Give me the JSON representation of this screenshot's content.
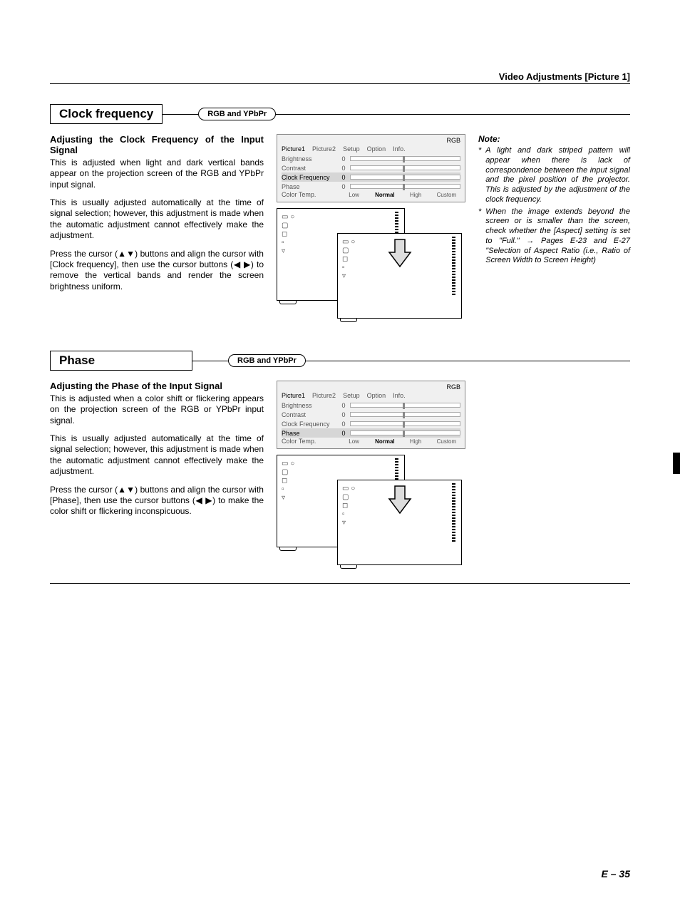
{
  "header": {
    "chapter": "Video Adjustments [Picture 1]"
  },
  "section1": {
    "title": "Clock frequency",
    "badge": "RGB and YPbPr",
    "subhead": "Adjusting the Clock Frequency of the Input Signal",
    "p1": "This is adjusted when light and dark vertical bands appear on the projection screen of the RGB and YPbPr input signal.",
    "p2": "This is usually adjusted automatically at the time of signal selection; however, this adjustment is made when the automatic adjustment cannot effectively make the adjustment.",
    "p3a": "Press the cursor (",
    "p3b": ") buttons and align the cursor with [Clock frequency], then use the cursor buttons (",
    "p3c": ") to remove the vertical bands and render the screen brightness uniform."
  },
  "menu": {
    "top": "RGB",
    "tabs": [
      "Picture1",
      "Picture2",
      "Setup",
      "Option",
      "Info."
    ],
    "rows": [
      {
        "label": "Brightness",
        "val": "0"
      },
      {
        "label": "Contrast",
        "val": "0"
      },
      {
        "label": "Clock Frequency",
        "val": "0"
      },
      {
        "label": "Phase",
        "val": "0"
      }
    ],
    "colortemp": {
      "label": "Color Temp.",
      "opts": [
        "Low",
        "Normal",
        "High",
        "Custom"
      ],
      "sel": "Normal"
    }
  },
  "notes": {
    "head": "Note:",
    "items": [
      "A light and dark striped pattern will appear when there is lack of correspondence between the input signal and the pixel position of the projector. This is adjusted by the adjustment of the clock frequency.",
      "When the image extends beyond the screen or is smaller than the screen, check whether the [Aspect] setting is set to \"Full.\" → Pages E-23 and E-27 \"Selection of Aspect Ratio (i.e., Ratio of Screen Width to Screen Height)"
    ]
  },
  "section2": {
    "title": "Phase",
    "badge": "RGB and YPbPr",
    "subhead": "Adjusting the Phase of the Input Signal",
    "p1": "This is adjusted when a color shift or flickering appears on the projection screen of the RGB or YPbPr input signal.",
    "p2": "This is usually adjusted automatically at the time of signal selection; however, this adjustment is made when the automatic adjustment cannot effectively make the adjustment.",
    "p3a": "Press the cursor (",
    "p3b": ") buttons and align the cursor with [Phase], then use the cursor buttons (",
    "p3c": ") to make the color shift or flickering inconspicuous."
  },
  "footer": {
    "page": "E – 35"
  },
  "glyphs": {
    "ud": "▲▼",
    "lr": "◀ ▶"
  }
}
